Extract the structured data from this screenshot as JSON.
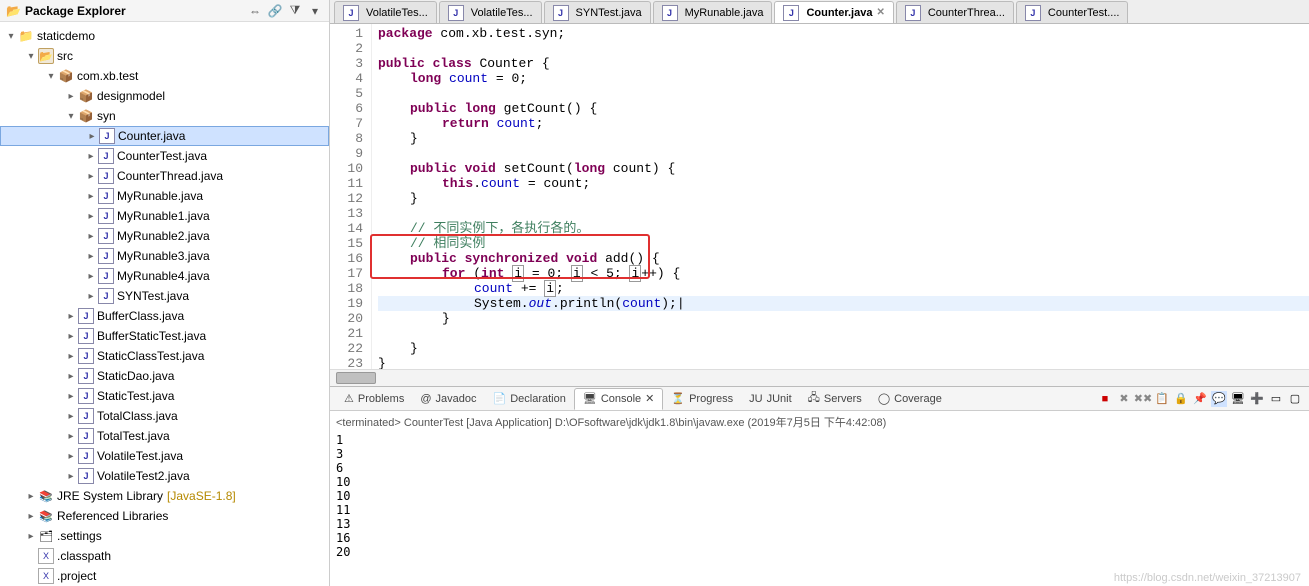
{
  "sidebar": {
    "title": "Package Explorer",
    "tree": {
      "project": "staticdemo",
      "src": "src",
      "pkg": "com.xb.test",
      "designmodel": "designmodel",
      "syn": "syn",
      "syn_files": [
        "Counter.java",
        "CounterTest.java",
        "CounterThread.java",
        "MyRunable.java",
        "MyRunable1.java",
        "MyRunable2.java",
        "MyRunable3.java",
        "MyRunable4.java",
        "SYNTest.java"
      ],
      "pkg_files": [
        "BufferClass.java",
        "BufferStaticTest.java",
        "StaticClassTest.java",
        "StaticDao.java",
        "StaticTest.java",
        "TotalClass.java",
        "TotalTest.java",
        "VolatileTest.java",
        "VolatileTest2.java"
      ],
      "jre": "JRE System Library",
      "jre_suffix": "[JavaSE-1.8]",
      "referenced": "Referenced Libraries",
      "settings": ".settings",
      "classpath": ".classpath",
      "projectfile": ".project"
    }
  },
  "tabs": [
    {
      "label": "VolatileTes..."
    },
    {
      "label": "VolatileTes..."
    },
    {
      "label": "SYNTest.java"
    },
    {
      "label": "MyRunable.java"
    },
    {
      "label": "Counter.java",
      "active": true
    },
    {
      "label": "CounterThrea..."
    },
    {
      "label": "CounterTest...."
    }
  ],
  "code": {
    "lines": [
      {
        "n": 1,
        "html": "<span class='kw'>package</span> com.xb.test.syn;"
      },
      {
        "n": 2,
        "html": ""
      },
      {
        "n": 3,
        "html": "<span class='kw'>public</span> <span class='kw'>class</span> Counter {"
      },
      {
        "n": 4,
        "html": "    <span class='kw'>long</span> <span class='fld'>count</span> = 0;"
      },
      {
        "n": 5,
        "html": ""
      },
      {
        "n": 6,
        "html": "    <span class='kw'>public</span> <span class='kw'>long</span> getCount() {"
      },
      {
        "n": 7,
        "html": "        <span class='kw'>return</span> <span class='fld'>count</span>;"
      },
      {
        "n": 8,
        "html": "    }"
      },
      {
        "n": 9,
        "html": ""
      },
      {
        "n": 10,
        "html": "    <span class='kw'>public</span> <span class='kw'>void</span> setCount(<span class='kw'>long</span> count) {"
      },
      {
        "n": 11,
        "html": "        <span class='kw'>this</span>.<span class='fld'>count</span> = count;"
      },
      {
        "n": 12,
        "html": "    }"
      },
      {
        "n": 13,
        "html": ""
      },
      {
        "n": 14,
        "html": "    <span class='cm'>// 不同实例下，各执行各的。</span>"
      },
      {
        "n": 15,
        "html": "    <span class='cm'>// 相同实例</span>"
      },
      {
        "n": 16,
        "html": "    <span class='kw'>public</span> <span class='kw'>synchronized</span> <span class='kw'>void</span> add() {"
      },
      {
        "n": 17,
        "html": "        <span class='kw'>for</span> (<span class='kw'>int</span> <span class='errbox'>i</span> = 0; <span class='errbox'>i</span> &lt; 5; <span class='errbox'>i</span>++) {"
      },
      {
        "n": 18,
        "html": "            <span class='fld'>count</span> += <span class='errbox'>i</span>;"
      },
      {
        "n": 19,
        "html": "            System.<span class='it'>out</span>.println(<span class='fld'>count</span>);|",
        "hl": true
      },
      {
        "n": 20,
        "html": "        }"
      },
      {
        "n": 21,
        "html": ""
      },
      {
        "n": 22,
        "html": "    }"
      },
      {
        "n": 23,
        "html": "}"
      }
    ]
  },
  "bottom": {
    "tabs": [
      "Problems",
      "Javadoc",
      "Declaration",
      "Console",
      "Progress",
      "JUnit",
      "Servers",
      "Coverage"
    ],
    "active": "Console",
    "status": "<terminated> CounterTest [Java Application] D:\\OFsoftware\\jdk\\jdk1.8\\bin\\javaw.exe (2019年7月5日 下午4:42:08)",
    "output": "1\n3\n6\n10\n10\n11\n13\n16\n20"
  },
  "watermark": "https://blog.csdn.net/weixin_37213907"
}
